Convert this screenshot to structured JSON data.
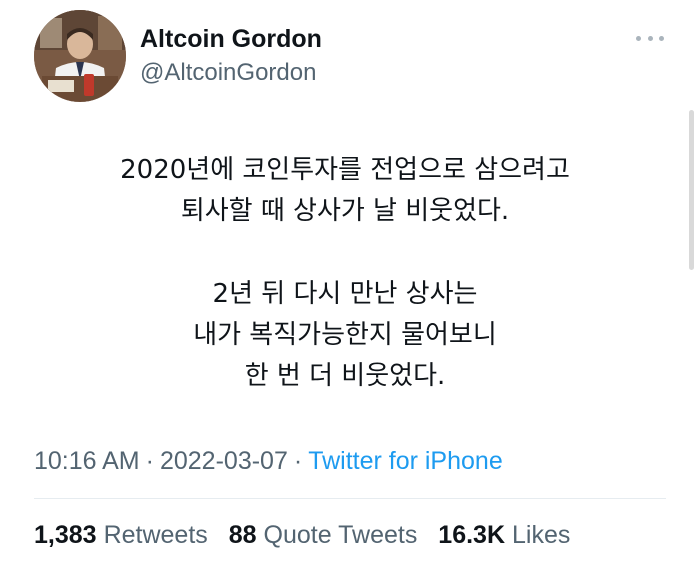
{
  "user": {
    "name": "Altcoin Gordon",
    "handle": "@AltcoinGordon",
    "avatar": "profile-photo"
  },
  "more_icon": "more-horizontal-icon",
  "tweet": {
    "lines": [
      "2020년에 코인투자를 전업으로 삼으려고",
      "퇴사할 때 상사가 날 비웃었다.",
      "",
      "2년 뒤 다시 만난 상사는",
      "내가 복직가능한지 물어보니",
      "한 번 더 비웃었다."
    ]
  },
  "meta": {
    "time": "10:16 AM",
    "separator": "·",
    "date": "2022-03-07",
    "source": "Twitter for iPhone"
  },
  "stats": {
    "retweets_count": "1,383",
    "retweets_label": "Retweets",
    "quotes_count": "88",
    "quotes_label": "Quote Tweets",
    "likes_count": "16.3K",
    "likes_label": "Likes"
  },
  "colors": {
    "text": "#0f1419",
    "secondary": "#536471",
    "link": "#1d9bf0",
    "divider": "#e6ecf0"
  }
}
